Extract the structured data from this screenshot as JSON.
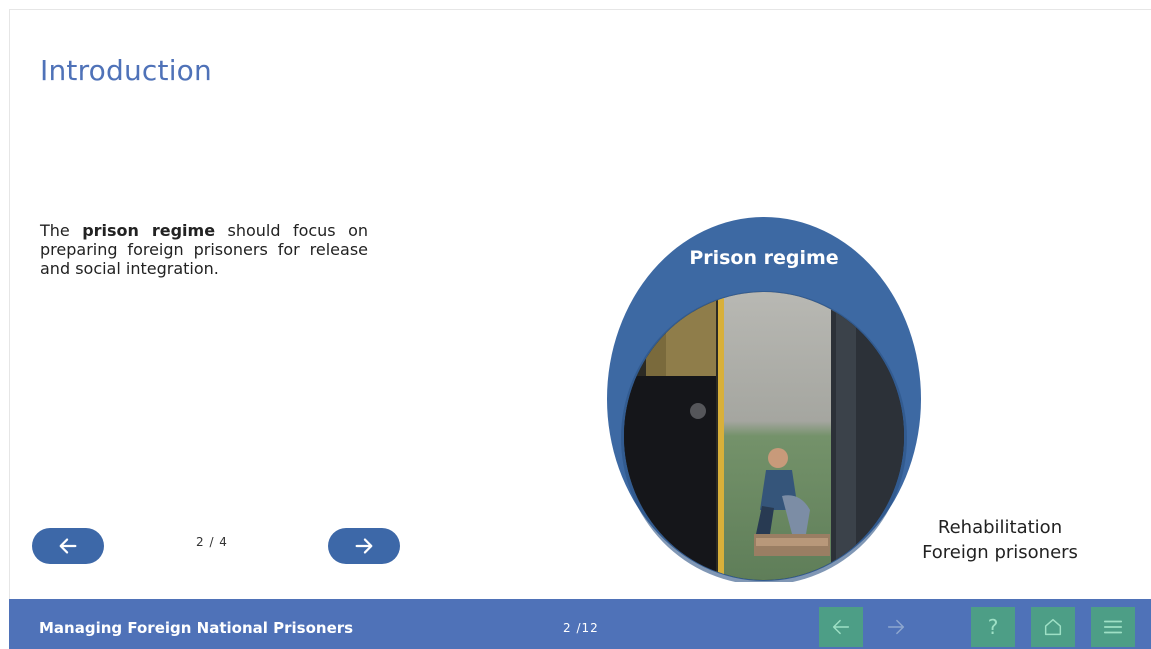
{
  "slide": {
    "title": "Introduction",
    "text_before": "The ",
    "text_bold": "prison regime",
    "text_after": " should focus on preparing foreign prisoners for release and social integration.",
    "sub_page": "2 / 4",
    "medallion_label": "Prison regime",
    "caption_line1": "Rehabilitation",
    "caption_line2": "Foreign prisoners"
  },
  "footer": {
    "course_title": "Managing Foreign National Prisoners",
    "page_count": "2 /12",
    "help_label": "?"
  },
  "icons": {
    "sub_prev": "arrow-left-icon",
    "sub_next": "arrow-right-icon",
    "nav_prev": "arrow-left-icon",
    "nav_next": "arrow-right-icon",
    "home": "home-icon",
    "menu": "menu-icon"
  },
  "colors": {
    "title": "#4f72b8",
    "footer": "#4f72b8",
    "pill": "#3d68a8",
    "footer_button": "#4d9e86",
    "medallion": "#3d69a3"
  }
}
